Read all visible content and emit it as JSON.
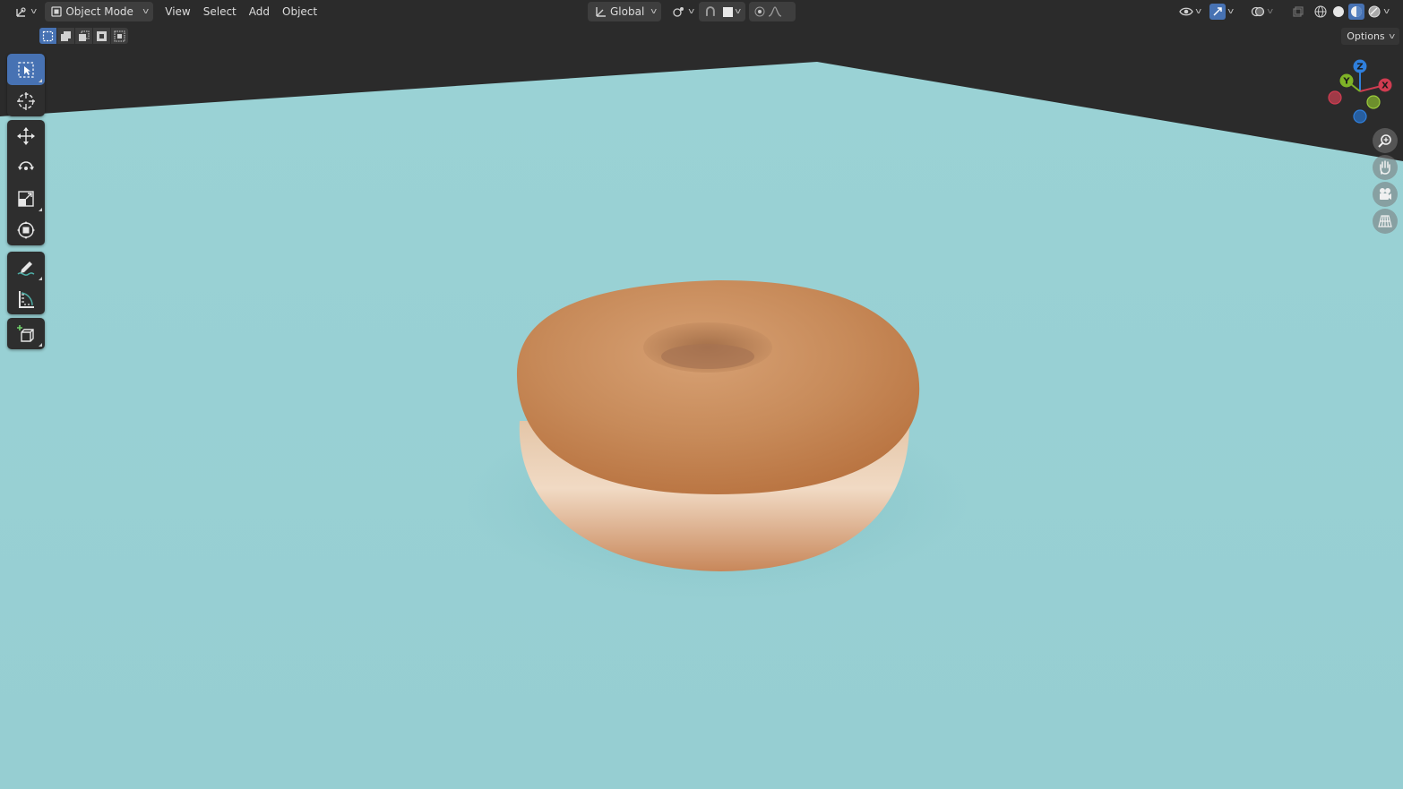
{
  "header": {
    "editor_type_icon": "axes-editor-icon",
    "mode_label": "Object Mode",
    "menus": [
      "View",
      "Select",
      "Add",
      "Object"
    ],
    "transform_orientation": "Global",
    "options_label": "Options"
  },
  "toolbar": {
    "tools": [
      "select-box",
      "cursor",
      "move",
      "rotate",
      "scale",
      "transform",
      "annotate",
      "measure",
      "add-cube"
    ],
    "active_tool": "select-box"
  },
  "gizmo": {
    "x": "X",
    "y": "Y",
    "z": "Z"
  },
  "colors": {
    "accent": "#4772b3",
    "floor": "#97cfd2",
    "background": "#2b2b2b",
    "axis_x": "#d03c51",
    "axis_y": "#7fb327",
    "axis_z": "#2f7fdc"
  }
}
